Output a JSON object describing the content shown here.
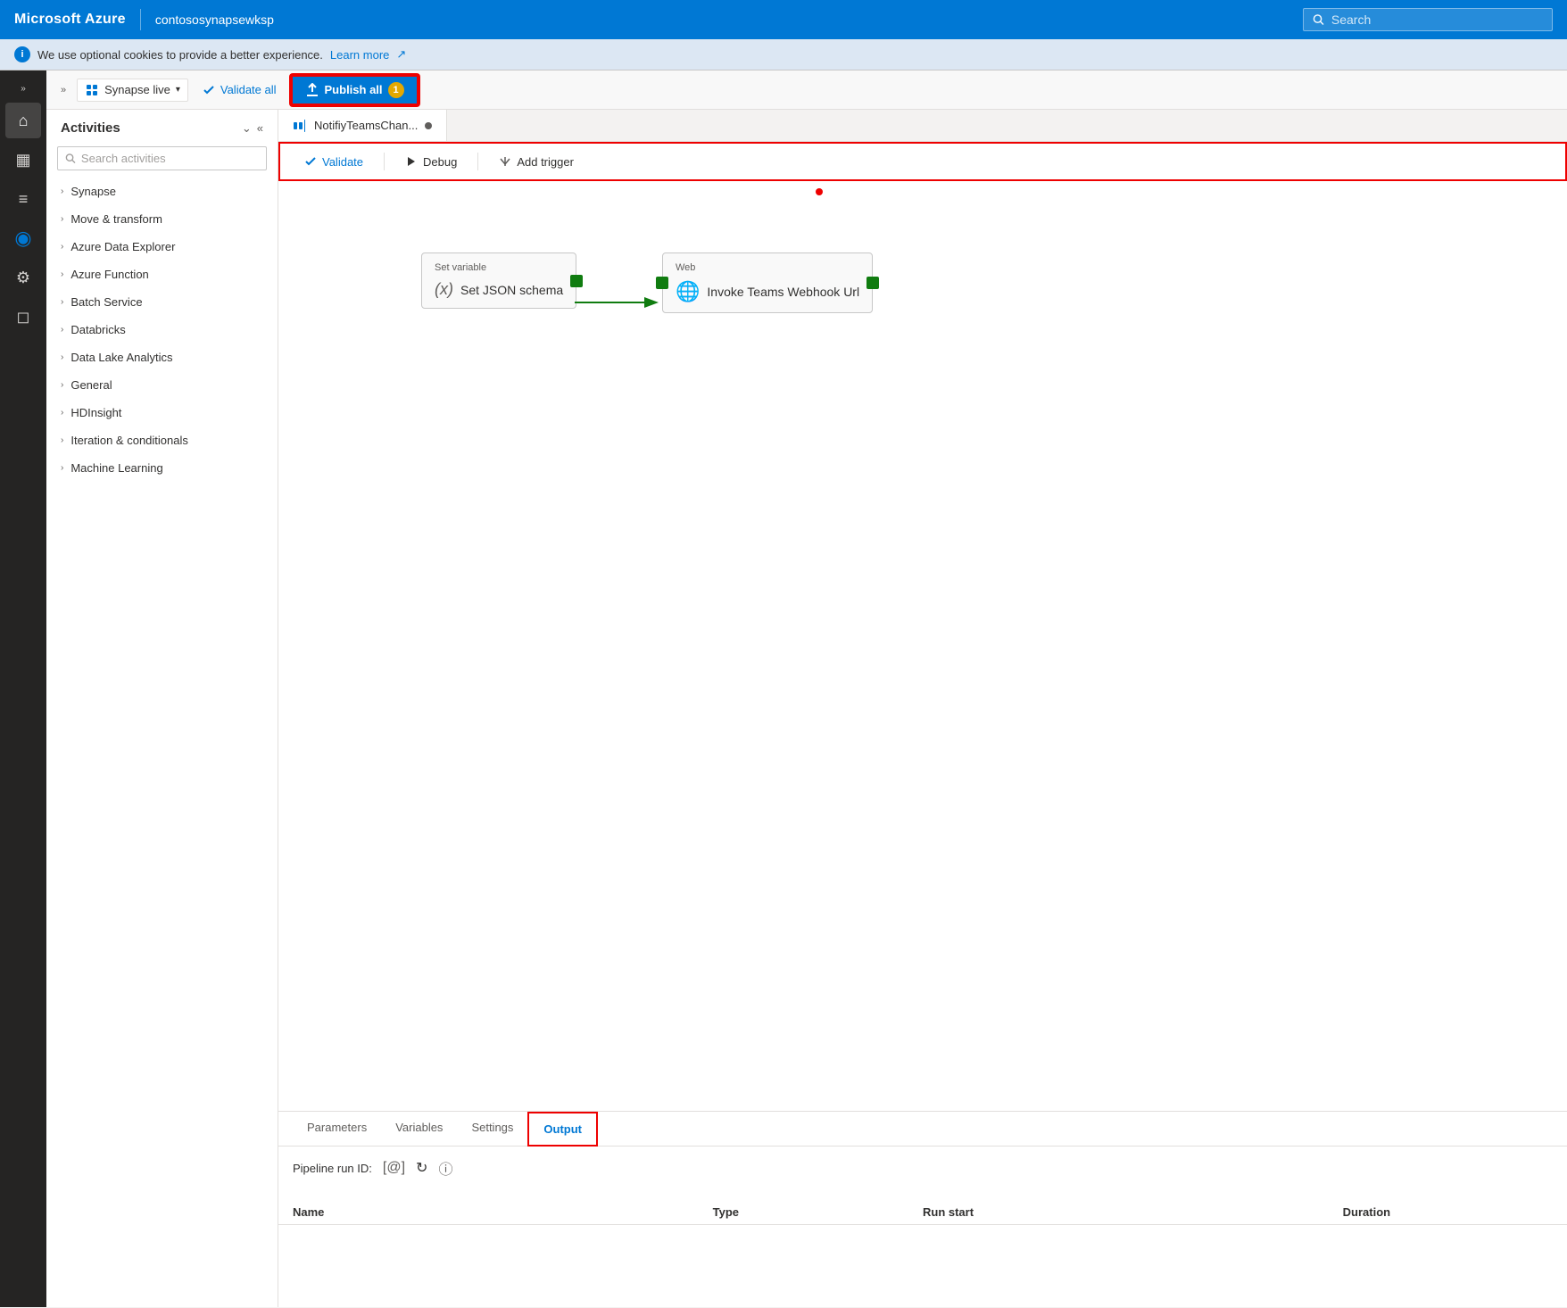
{
  "brand": "Microsoft Azure",
  "workspace": "contososynapsewksp",
  "search": {
    "placeholder": "Search"
  },
  "cookie_banner": {
    "text": "We use optional cookies to provide a better experience.",
    "link": "Learn more"
  },
  "toolbar": {
    "expand_label": "»",
    "synapse_live_label": "Synapse live",
    "validate_all_label": "Validate all",
    "publish_all_label": "Publish all",
    "publish_badge": "1"
  },
  "tab": {
    "name": "NotifiyTeamsChan...",
    "dot_visible": true
  },
  "pipeline_toolbar": {
    "validate_label": "Validate",
    "debug_label": "Debug",
    "add_trigger_label": "Add trigger"
  },
  "activities": {
    "title": "Activities",
    "search_placeholder": "Search activities",
    "items": [
      {
        "label": "Synapse"
      },
      {
        "label": "Move & transform"
      },
      {
        "label": "Azure Data Explorer"
      },
      {
        "label": "Azure Function"
      },
      {
        "label": "Batch Service"
      },
      {
        "label": "Databricks"
      },
      {
        "label": "Data Lake Analytics"
      },
      {
        "label": "General"
      },
      {
        "label": "HDInsight"
      },
      {
        "label": "Iteration & conditionals"
      },
      {
        "label": "Machine Learning"
      }
    ]
  },
  "nodes": {
    "set_variable": {
      "header": "Set variable",
      "body": "Set JSON schema"
    },
    "web": {
      "header": "Web",
      "body": "Invoke Teams Webhook Url"
    }
  },
  "bottom_tabs": [
    {
      "label": "Parameters"
    },
    {
      "label": "Variables"
    },
    {
      "label": "Settings"
    },
    {
      "label": "Output",
      "active": true
    }
  ],
  "pipeline_run": {
    "label": "Pipeline run ID:"
  },
  "table_headers": [
    "Name",
    "Type",
    "Run start",
    "Duration"
  ],
  "sidebar_icons": [
    {
      "name": "home-icon",
      "symbol": "⌂",
      "active": true
    },
    {
      "name": "database-icon",
      "symbol": "▦"
    },
    {
      "name": "document-icon",
      "symbol": "≡"
    },
    {
      "name": "flow-icon",
      "symbol": "◈"
    },
    {
      "name": "gear-icon",
      "symbol": "⚙"
    },
    {
      "name": "briefcase-icon",
      "symbol": "◻"
    }
  ]
}
